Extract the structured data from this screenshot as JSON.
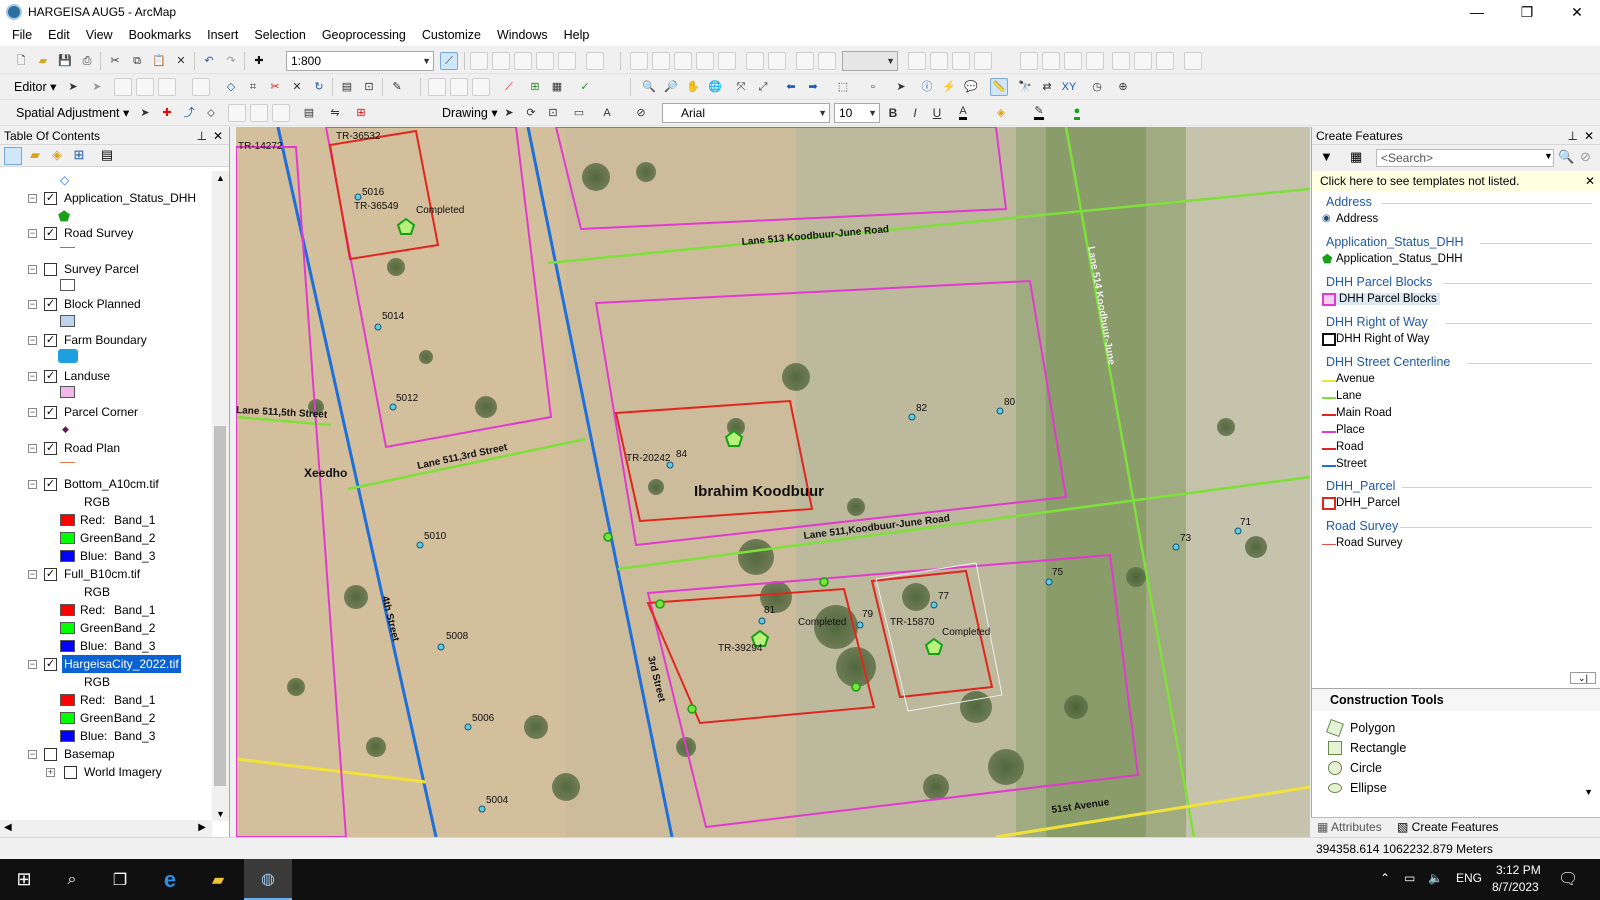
{
  "window": {
    "title": "HARGEISA AUG5 - ArcMap",
    "min": "—",
    "max": "❐",
    "close": "✕"
  },
  "menu": [
    "File",
    "Edit",
    "View",
    "Bookmarks",
    "Insert",
    "Selection",
    "Geoprocessing",
    "Customize",
    "Windows",
    "Help"
  ],
  "toolbar": {
    "scale": "1:800",
    "editor_label": "Editor ▾",
    "spatial_adjustment_label": "Spatial Adjustment ▾",
    "drawing_label": "Drawing ▾",
    "font_name": "Arial",
    "font_size": "10",
    "bold": "B",
    "italic": "I",
    "underline": "U",
    "text_tool": "A"
  },
  "toc": {
    "title": "Table Of Contents",
    "pin": "⊥",
    "close": "✕",
    "layers": [
      {
        "name": "Application_Status_DHH",
        "checked": true
      },
      {
        "name": "Road Survey",
        "checked": true
      },
      {
        "name": "Survey Parcel",
        "checked": false
      },
      {
        "name": "Block Planned",
        "checked": true
      },
      {
        "name": "Farm Boundary",
        "checked": true
      },
      {
        "name": "Landuse",
        "checked": true
      },
      {
        "name": "Parcel Corner",
        "checked": true
      },
      {
        "name": "Road Plan",
        "checked": true
      },
      {
        "name": "Bottom_A10cm.tif",
        "checked": true,
        "sub": "RGB",
        "bands": [
          {
            "c": "Red:",
            "b": "Band_1"
          },
          {
            "c": "Green:",
            "b": "Band_2"
          },
          {
            "c": "Blue:",
            "b": "Band_3"
          }
        ]
      },
      {
        "name": "Full_B10cm.tif",
        "checked": true,
        "sub": "RGB",
        "bands": [
          {
            "c": "Red:",
            "b": "Band_1"
          },
          {
            "c": "Green:",
            "b": "Band_2"
          },
          {
            "c": "Blue:",
            "b": "Band_3"
          }
        ]
      },
      {
        "name": "HargeisaCity_2022.tif",
        "checked": true,
        "selected": true,
        "sub": "RGB",
        "bands": [
          {
            "c": "Red:",
            "b": "Band_1"
          },
          {
            "c": "Green:",
            "b": "Band_2"
          },
          {
            "c": "Blue:",
            "b": "Band_3"
          }
        ]
      },
      {
        "name": "Basemap",
        "checked": false
      },
      {
        "name": "World Imagery",
        "checked": false
      }
    ]
  },
  "map": {
    "labels": {
      "tr14272": "TR-14272",
      "tr36532": "TR-36532",
      "p5016": "5016",
      "tr36549": "TR-36549",
      "completed1": "Completed",
      "lane513": "Lane 513 Koodbuur-June Road",
      "p5014": "5014",
      "lane511_5th": "Lane 511,5th Street",
      "p5012": "5012",
      "lane511_3rd": "Lane 511,3rd Street",
      "xeedho": "Xeedho",
      "tr20242": "TR-20242",
      "p84": "84",
      "owner": "Ibrahim Koodbuur",
      "p82": "82",
      "p80": "80",
      "lane511_kj": "Lane 511,Koodbuur-June Road",
      "p5010": "5010",
      "fourth": "4th Street",
      "p5008": "5008",
      "third": "3rd Street",
      "p81": "81",
      "completed2": "Completed",
      "tr39294": "TR-39294",
      "p79": "79",
      "p77": "77",
      "tr15870": "TR-15870",
      "completed3": "Completed",
      "p75": "75",
      "p73": "73",
      "p71": "71",
      "p5006": "5006",
      "p5004": "5004",
      "first_ave": "51st Avenue",
      "vert_road": "Lane 514 Koodbuur-June"
    }
  },
  "create": {
    "title": "Create Features",
    "search_placeholder": "<Search>",
    "note": "Click here to see templates not listed.",
    "groups": [
      {
        "name": "Address",
        "items": [
          "Address"
        ]
      },
      {
        "name": "Application_Status_DHH",
        "items": [
          "Application_Status_DHH"
        ]
      },
      {
        "name": "DHH Parcel Blocks",
        "items": [
          "DHH Parcel Blocks"
        ]
      },
      {
        "name": "DHH Right of Way",
        "items": [
          "DHH Right of Way"
        ]
      },
      {
        "name": "DHH Street Centerline",
        "items": [
          "Avenue",
          "Lane",
          "Main Road",
          "Place",
          "Road",
          "Street"
        ]
      },
      {
        "name": "DHH_Parcel",
        "items": [
          "DHH_Parcel"
        ]
      },
      {
        "name": "Road Survey",
        "items": [
          "Road Survey"
        ]
      }
    ],
    "construction_title": "Construction Tools",
    "tools": [
      "Polygon",
      "Rectangle",
      "Circle",
      "Ellipse"
    ],
    "tab_attributes": "Attributes",
    "tab_create": "Create Features"
  },
  "status": {
    "coords": "394358.614  1062232.879 Meters"
  },
  "taskbar": {
    "lang": "ENG",
    "time": "3:12 PM",
    "date": "8/7/2023"
  },
  "colors": {
    "street": "#1e6fd9",
    "lane": "#7ee03a",
    "parcel": "#e0261e",
    "block": "#e23ad0",
    "avenue": "#f1e23a"
  }
}
